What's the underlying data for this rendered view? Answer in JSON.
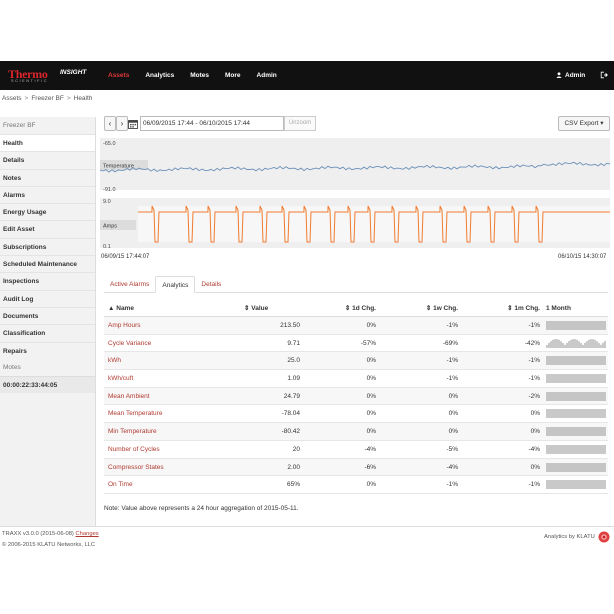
{
  "header": {
    "logo_main": "Thermo",
    "logo_insight": "INSIGHT",
    "logo_sub": "SCIENTIFIC",
    "nav": [
      "Assets",
      "Analytics",
      "Motes",
      "More",
      "Admin"
    ],
    "user": "Admin"
  },
  "breadcrumb": [
    "Assets",
    "Freezer BF",
    "Health"
  ],
  "sidebar": {
    "asset_heading": "Freezer BF",
    "items": [
      "Health",
      "Details",
      "Notes",
      "Alarms",
      "Energy Usage",
      "Edit Asset",
      "Subscriptions",
      "Scheduled Maintenance",
      "Inspections",
      "Audit Log",
      "Documents",
      "Classification",
      "Repairs"
    ],
    "motes_heading": "Motes",
    "mote_id": "00:00:22:33:44:05"
  },
  "toolbar": {
    "prev": "‹",
    "next": "›",
    "range": "06/09/2015 17:44 - 06/10/2015 17:44",
    "unzoom": "Unzoom",
    "csv": "CSV Export ▾"
  },
  "chart": {
    "temp_label": "Temperature",
    "temp_max": "-65.0",
    "temp_min": "-91.0",
    "amps_label": "Amps",
    "amps_max": "9.0",
    "amps_min": "0.1",
    "start": "06/09/15 17:44:07",
    "end": "06/10/15 14:30:07"
  },
  "tabs": [
    "Active Alarms",
    "Analytics",
    "Details"
  ],
  "table": {
    "headers": [
      "Name",
      "Value",
      "1d Chg.",
      "1w Chg.",
      "1m Chg.",
      "1 Month"
    ],
    "rows": [
      {
        "name": "Amp Hours",
        "value": "213.50",
        "d1": "0%",
        "w1": "-1%",
        "m1": "-1%"
      },
      {
        "name": "Cycle Variance",
        "value": "9.71",
        "d1": "-57%",
        "w1": "-69%",
        "m1": "-42%"
      },
      {
        "name": "kWh",
        "value": "25.0",
        "d1": "0%",
        "w1": "-1%",
        "m1": "-1%"
      },
      {
        "name": "kWh/cuft",
        "value": "1.09",
        "d1": "0%",
        "w1": "-1%",
        "m1": "-1%"
      },
      {
        "name": "Mean Ambient",
        "value": "24.79",
        "d1": "0%",
        "w1": "0%",
        "m1": "-2%"
      },
      {
        "name": "Mean Temperature",
        "value": "-78.04",
        "d1": "0%",
        "w1": "0%",
        "m1": "0%"
      },
      {
        "name": "Min Temperature",
        "value": "-80.42",
        "d1": "0%",
        "w1": "0%",
        "m1": "0%"
      },
      {
        "name": "Number of Cycles",
        "value": "20",
        "d1": "-4%",
        "w1": "-5%",
        "m1": "-4%"
      },
      {
        "name": "Compressor States",
        "value": "2.00",
        "d1": "-6%",
        "w1": "-4%",
        "m1": "0%"
      },
      {
        "name": "On Time",
        "value": "65%",
        "d1": "0%",
        "w1": "-1%",
        "m1": "-1%"
      }
    ]
  },
  "note": "Note: Value above represents a 24 hour aggregation of 2015-05-11.",
  "footer": {
    "version": "TRAXX v3.0.0 (2015-06-08)",
    "changes": "Changes",
    "copyright": "© 2006-2015 KLATU Networks, LLC",
    "powered": "Analytics by KLATU"
  },
  "colors": {
    "brand_red": "#d9262c",
    "link_red": "#b03a30",
    "temp_line": "#6a8fb8",
    "amps_line": "#f07b2d",
    "topbar": "#111111"
  }
}
